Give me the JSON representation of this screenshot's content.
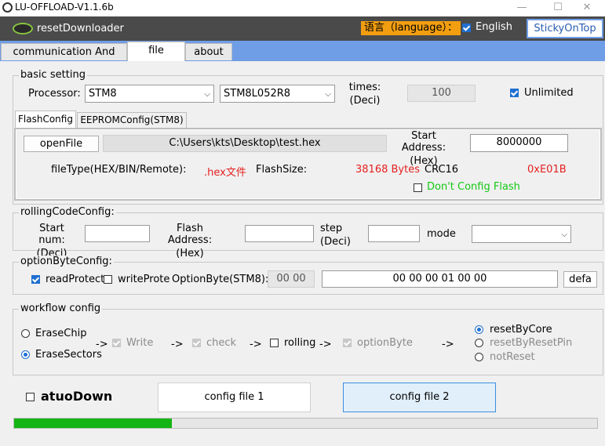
{
  "window": {
    "title": "LU-OFFLOAD-V1.1.6b"
  },
  "app": {
    "name": "resetDownloader",
    "language_label": "语言（language）：",
    "english_label": "English",
    "sticky_label": "StickyOnTop"
  },
  "tabs": [
    {
      "label": "communication And status"
    },
    {
      "label": "file setting"
    },
    {
      "label": "about us"
    }
  ],
  "basic": {
    "legend": "basic setting",
    "processor_label": "Processor:",
    "processor_value": "STM8",
    "chip_value": "STM8L052R8",
    "times_label_1": "times:",
    "times_label_2": "(Deci)",
    "times_value": "100",
    "unlimited_label": "Unlimited",
    "unlimited_checked": true
  },
  "subtabs": [
    {
      "label": "FlashConfig"
    },
    {
      "label": "EEPROMConfig(STM8)"
    }
  ],
  "flash": {
    "open_button": "openFile",
    "file_path": "C:\\Users\\kts\\Desktop\\test.hex",
    "start_addr_label_1": "Start Address:",
    "start_addr_label_2": "(Hex)",
    "start_addr_value": "8000000",
    "filetype_label": "fileType(HEX/BIN/Remote):",
    "filetype_value": ".hex文件",
    "flashsize_label": "FlashSize:",
    "flashsize_value": "38168 Bytes",
    "crc_label": "CRC16",
    "crc_value": "0xE01B",
    "dont_config_label": "Don't Config Flash",
    "dont_config_checked": false
  },
  "rolling": {
    "legend": "rollingCodeConfig:",
    "start_num_1": "Start num:",
    "start_num_2": "(Deci)",
    "flash_addr_1": "Flash Address:",
    "flash_addr_2": "(Hex)",
    "step_1": "step",
    "step_2": "(Deci)",
    "mode_label": "mode"
  },
  "optionbyte": {
    "legend": "optionByteConfig:",
    "read_protect": "readProtect",
    "read_protect_checked": true,
    "write_protect": "writeProtec",
    "write_protect_checked": false,
    "ob_label": "OptionByte(STM8):",
    "ob_small_value": "00 00",
    "ob_value": "00 00 00 01 00 00",
    "default_button": "defa"
  },
  "workflow": {
    "legend": "workflow config",
    "erase_chip": "EraseChip",
    "erase_sectors": "EraseSectors",
    "arrow": "->",
    "write": "Write",
    "check": "check",
    "rolling": "rolling",
    "optionbyte": "optionByte",
    "reset_by_core": "resetByCore",
    "reset_by_pin": "resetByResetPin",
    "not_reset": "notReset"
  },
  "bottom": {
    "auto_down": "atuoDown",
    "config1": "config file 1",
    "config2": "config file 2",
    "progress": 0.27
  },
  "colors": {
    "appbar": "#4a4a4a",
    "tabbar": "#6f9ee6",
    "language_bg": "#f29e10",
    "progress": "#14b414",
    "accent": "#1f6fd1"
  }
}
